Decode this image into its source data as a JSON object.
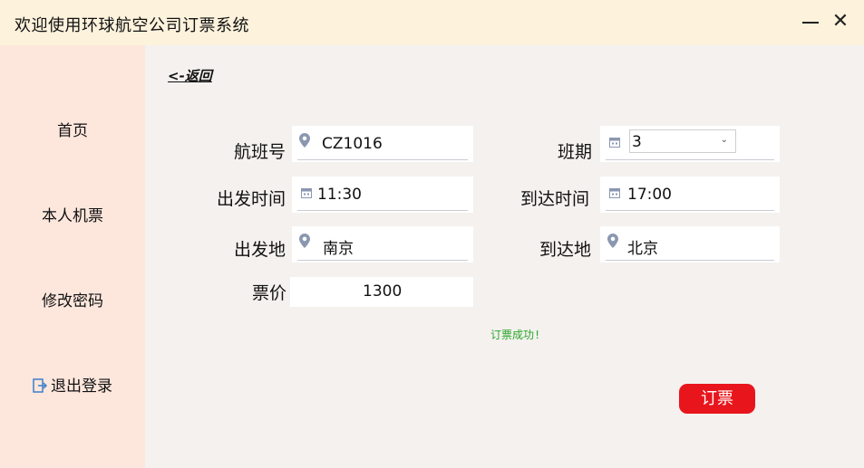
{
  "window": {
    "title": "欢迎使用环球航空公司订票系统",
    "close_glyph": "✕"
  },
  "sidebar": {
    "items": [
      {
        "label": "首页"
      },
      {
        "label": "本人机票"
      },
      {
        "label": "修改密码"
      },
      {
        "label": "退出登录",
        "icon": "logout-icon"
      }
    ]
  },
  "main": {
    "back_link": "<-返回",
    "fields": {
      "flight_no": {
        "label": "航班号",
        "value": "CZ1016"
      },
      "schedule": {
        "label": "班期",
        "value": "3"
      },
      "depart_time": {
        "label": "出发时间",
        "value": "11:30"
      },
      "arrive_time": {
        "label": "到达时间",
        "value": "17:00"
      },
      "origin": {
        "label": "出发地",
        "value": "南京"
      },
      "destination": {
        "label": "到达地",
        "value": "北京"
      },
      "price": {
        "label": "票价",
        "value": "1300"
      }
    },
    "status_message": "订票成功!",
    "book_button": "订票"
  },
  "colors": {
    "titlebar_bg": "#fdf2dc",
    "sidebar_bg": "#fde7dd",
    "main_bg": "#f4f1ee",
    "accent_red": "#e8161c",
    "success_green": "#29a829"
  }
}
